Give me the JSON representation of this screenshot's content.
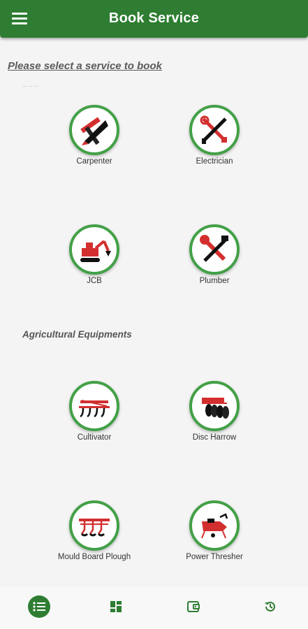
{
  "app_bar": {
    "title": "Book Service",
    "menu_icon": "hamburger-menu-icon",
    "background": "#2e7d32"
  },
  "prompt": "Please select a service to book",
  "sections": [
    {
      "title": "",
      "services": [
        {
          "label": "Carpenter",
          "icon": "carpenter-icon"
        },
        {
          "label": "Electrician",
          "icon": "electrician-icon"
        },
        {
          "label": "JCB",
          "icon": "jcb-icon"
        },
        {
          "label": "Plumber",
          "icon": "plumber-icon"
        }
      ]
    },
    {
      "title": "Agricultural Equipments",
      "services": [
        {
          "label": "Cultivator",
          "icon": "cultivator-icon"
        },
        {
          "label": "Disc Harrow",
          "icon": "disc-harrow-icon"
        },
        {
          "label": "Mould Board Plough",
          "icon": "plough-icon"
        },
        {
          "label": "Power Thresher",
          "icon": "thresher-icon"
        }
      ]
    }
  ],
  "bottom_nav": [
    {
      "icon": "list-icon",
      "active": true
    },
    {
      "icon": "dashboard-icon",
      "active": false
    },
    {
      "icon": "wallet-icon",
      "active": false
    },
    {
      "icon": "history-icon",
      "active": false
    }
  ],
  "colors": {
    "accent": "#2e7d32",
    "ring": "#43a047",
    "icon_red": "#d32f2f"
  }
}
